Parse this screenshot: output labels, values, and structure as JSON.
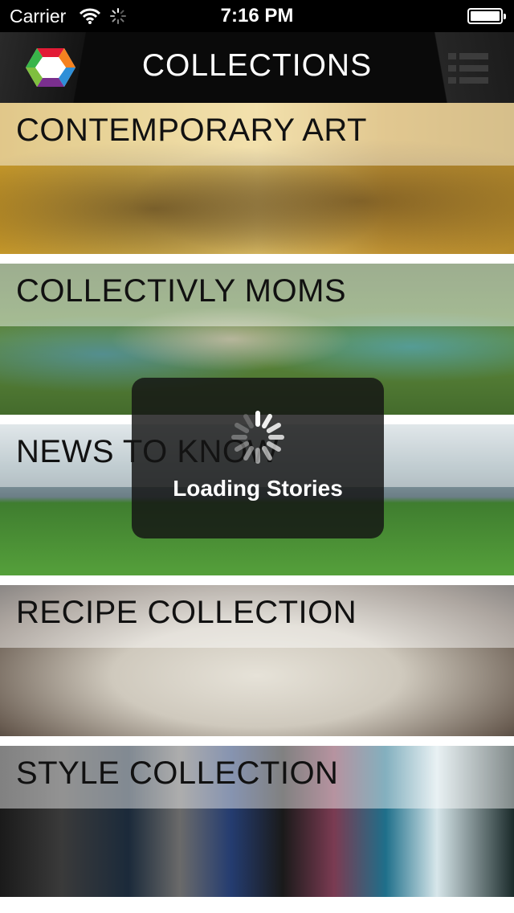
{
  "status_bar": {
    "carrier": "Carrier",
    "time": "7:16 PM"
  },
  "nav": {
    "title": "COLLECTIONS",
    "logo_icon": "hexagon-logo-icon",
    "menu_icon": "list-menu-icon"
  },
  "collections": [
    {
      "label": "CONTEMPORARY ART"
    },
    {
      "label": "COLLECTIVLY MOMS"
    },
    {
      "label": "NEWS TO KNOW"
    },
    {
      "label": "RECIPE COLLECTION"
    },
    {
      "label": "STYLE COLLECTION"
    }
  ],
  "loading": {
    "text": "Loading Stories"
  },
  "colors": {
    "nav_bg": "#0a0a0a",
    "status_bg": "#000000",
    "overlay_bg": "#141414"
  }
}
